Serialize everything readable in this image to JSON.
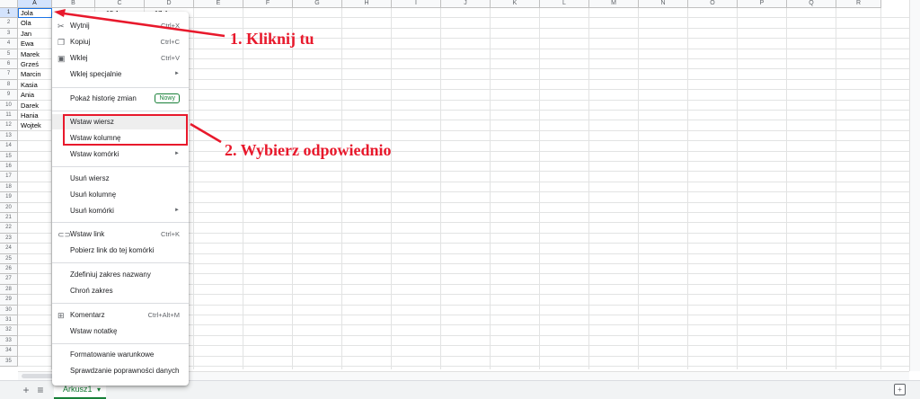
{
  "grid": {
    "columns": [
      "A",
      "B",
      "C",
      "D",
      "E",
      "F",
      "G",
      "H",
      "I",
      "J",
      "K",
      "L",
      "M",
      "N",
      "O",
      "P",
      "Q",
      "R"
    ],
    "selected_column": "A",
    "rows": [
      "1",
      "2",
      "3",
      "4",
      "5",
      "6",
      "7",
      "8",
      "9",
      "10",
      "11",
      "12",
      "13",
      "14",
      "15",
      "16",
      "17",
      "18",
      "19",
      "20",
      "21",
      "22",
      "23",
      "24",
      "25",
      "26",
      "27",
      "28",
      "29",
      "30",
      "31",
      "32",
      "33",
      "34",
      "35"
    ],
    "selected_row": "1",
    "column_a_values": [
      "Jola",
      "Ola",
      "Jan",
      "Ewa",
      "Marek",
      "Grześ",
      "Marcin",
      "Kasia",
      "Ania",
      "Darek",
      "Hania",
      "Wojtek"
    ],
    "partial_values_row1": [
      "15,1",
      "17,4"
    ]
  },
  "context_menu": {
    "cut": {
      "label": "Wytnij",
      "shortcut": "Ctrl+X",
      "icon": "scissors-icon"
    },
    "copy": {
      "label": "Kopiuj",
      "shortcut": "Ctrl+C",
      "icon": "copy-icon"
    },
    "paste": {
      "label": "Wklej",
      "shortcut": "Ctrl+V",
      "icon": "clipboard-icon"
    },
    "paste_special": {
      "label": "Wklej specjalnie",
      "arrow": "►"
    },
    "history": {
      "label": "Pokaż historię zmian",
      "badge": "Nowy"
    },
    "insert_row": {
      "label": "Wstaw wiersz"
    },
    "insert_column": {
      "label": "Wstaw kolumnę"
    },
    "insert_cells": {
      "label": "Wstaw komórki",
      "arrow": "►"
    },
    "delete_row": {
      "label": "Usuń wiersz"
    },
    "delete_column": {
      "label": "Usuń kolumnę"
    },
    "delete_cells": {
      "label": "Usuń komórki",
      "arrow": "►"
    },
    "insert_link": {
      "label": "Wstaw link",
      "shortcut": "Ctrl+K",
      "icon": "link-icon"
    },
    "get_link": {
      "label": "Pobierz link do tej komórki"
    },
    "named_range": {
      "label": "Zdefiniuj zakres nazwany"
    },
    "protect_range": {
      "label": "Chroń zakres"
    },
    "comment": {
      "label": "Komentarz",
      "shortcut": "Ctrl+Alt+M",
      "icon": "comment-icon"
    },
    "note": {
      "label": "Wstaw notatkę"
    },
    "conditional_format": {
      "label": "Formatowanie warunkowe"
    },
    "data_validation": {
      "label": "Sprawdzanie poprawności danych"
    }
  },
  "sheet_bar": {
    "add_label": "+",
    "list_label": "≡",
    "tab_label": "Arkusz1",
    "tab_arrow": "▾",
    "explore_label": "+"
  },
  "annotations": {
    "step1": "1. Kliknij tu",
    "step2": "2. Wybierz odpowiednio"
  },
  "colors": {
    "annotation_red": "#e8192c",
    "accent_green": "#188038",
    "selection_blue": "#1a73e8"
  }
}
